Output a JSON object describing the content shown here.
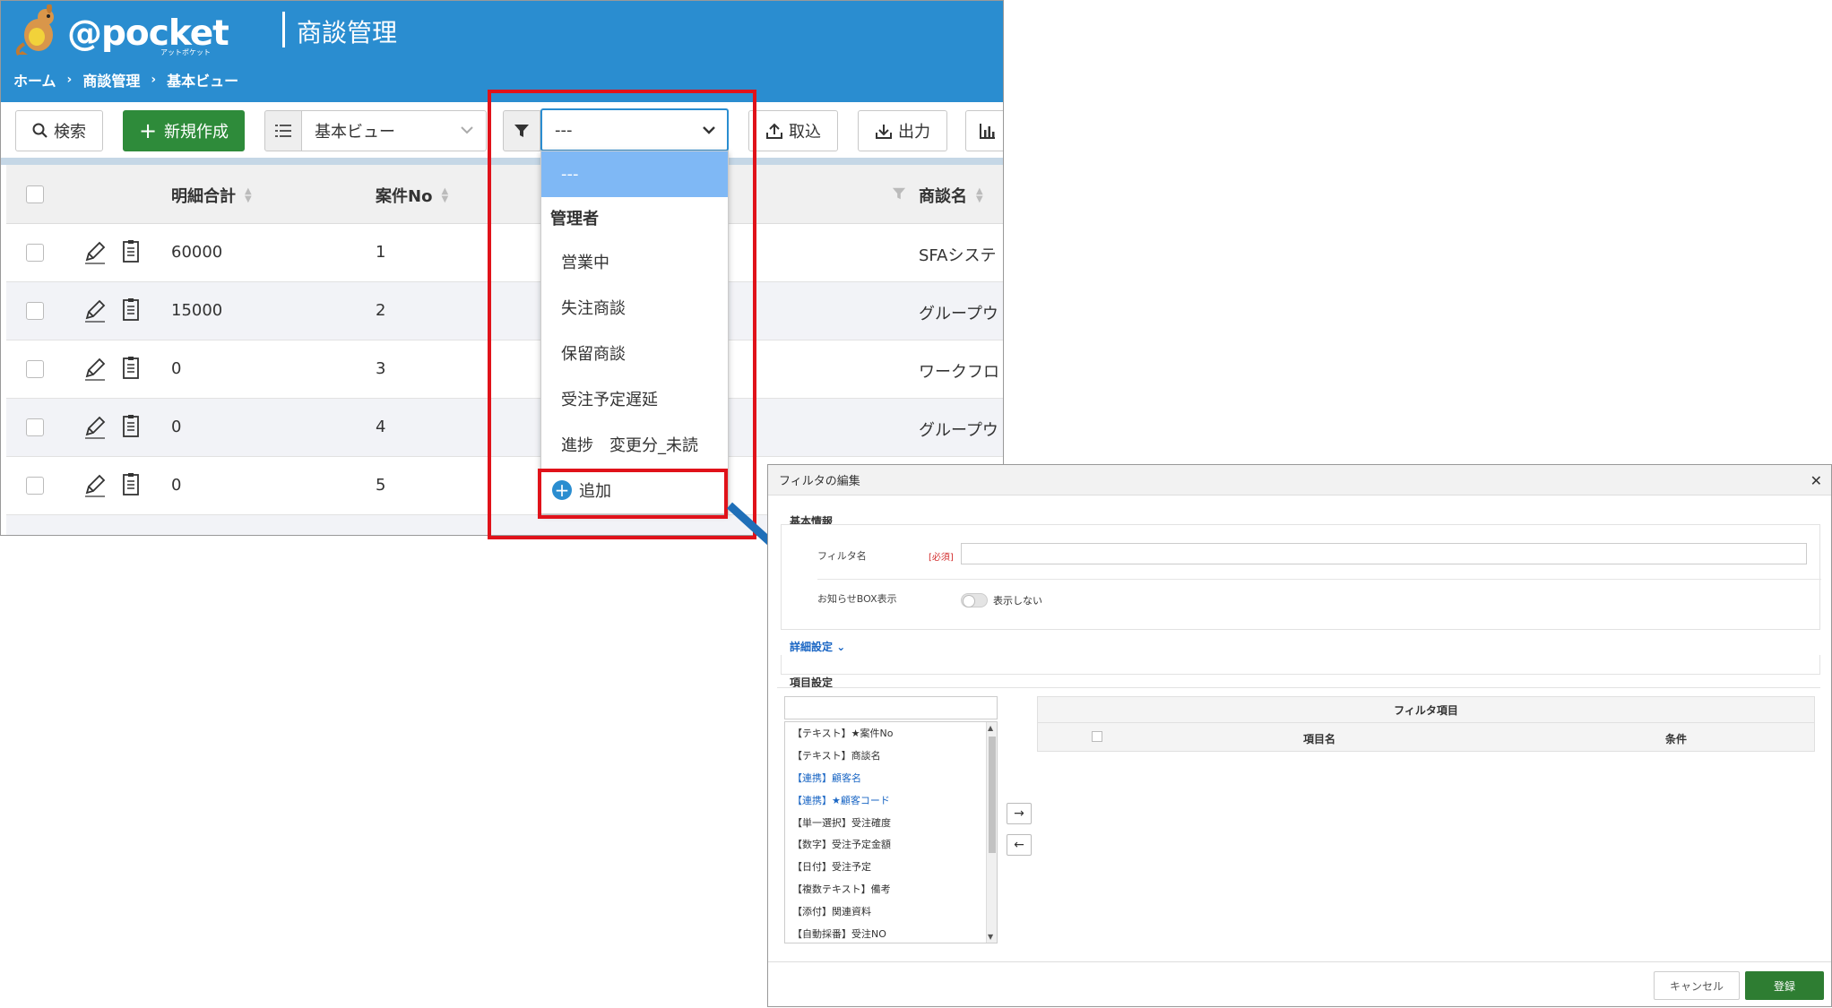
{
  "app": {
    "logo_text": "@pocket",
    "logo_sub": "アットポケット",
    "title": "商談管理",
    "breadcrumb": [
      "ホーム",
      "商談管理",
      "基本ビュー"
    ]
  },
  "toolbar": {
    "search_label": "検索",
    "new_label": "新規作成",
    "view_value": "基本ビュー",
    "filter_value": "---",
    "import_label": "取込",
    "export_label": "出力"
  },
  "table": {
    "columns": [
      "明細合計",
      "案件No",
      "商談名"
    ],
    "rows": [
      {
        "total": "60000",
        "no": "1",
        "name": "SFAシステ"
      },
      {
        "total": "15000",
        "no": "2",
        "name": "グループウ"
      },
      {
        "total": "0",
        "no": "3",
        "name": "ワークフロ"
      },
      {
        "total": "0",
        "no": "4",
        "name": "グループウ"
      },
      {
        "total": "0",
        "no": "5",
        "name": ""
      }
    ]
  },
  "dropdown": {
    "selected": "---",
    "group": "管理者",
    "items": [
      "営業中",
      "失注商談",
      "保留商談",
      "受注予定遅延",
      "進捗　変更分_未読"
    ],
    "add_label": "追加"
  },
  "dialog": {
    "title": "フィルタの編集",
    "basic_section": "基本情報",
    "filter_name_label": "フィルタ名",
    "required_label": "[必須]",
    "notice_label": "お知らせBOX表示",
    "notice_toggle_text": "表示しない",
    "advanced_link": "詳細設定",
    "items_section": "項目設定",
    "field_list": [
      {
        "text": "【テキスト】★案件No",
        "linked": false
      },
      {
        "text": "【テキスト】商談名",
        "linked": false
      },
      {
        "text": "【連携】顧客名",
        "linked": true
      },
      {
        "text": "【連携】★顧客コード",
        "linked": true
      },
      {
        "text": "【単一選択】受注確度",
        "linked": false
      },
      {
        "text": "【数字】受注予定金額",
        "linked": false
      },
      {
        "text": "【日付】受注予定",
        "linked": false
      },
      {
        "text": "【複数テキスト】備考",
        "linked": false
      },
      {
        "text": "【添付】関連資料",
        "linked": false
      },
      {
        "text": "【自動採番】受注NO",
        "linked": false
      }
    ],
    "filter_items_header": "フィルタ項目",
    "col_item_name": "項目名",
    "col_condition": "条件",
    "cancel_label": "キャンセル",
    "register_label": "登録"
  },
  "colors": {
    "header_blue": "#2a8dd0",
    "primary_green": "#2e8b3a",
    "highlight_red": "#e0121a",
    "link_blue": "#1a66c4"
  }
}
